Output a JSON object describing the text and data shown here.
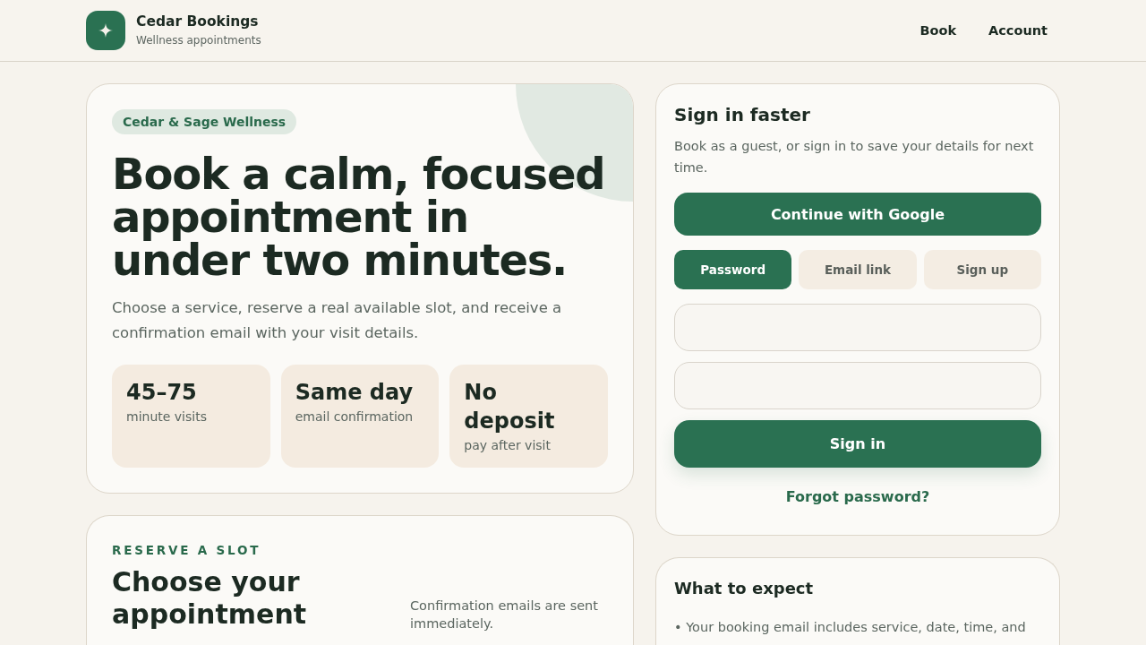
{
  "header": {
    "brand": {
      "name": "Cedar Bookings",
      "tagline": "Wellness appointments"
    },
    "nav": [
      {
        "label": "Book"
      },
      {
        "label": "Account"
      }
    ]
  },
  "hero": {
    "badge": "Cedar & Sage Wellness",
    "title": "Book a calm, focused appointment in under two minutes.",
    "description": "Choose a service, reserve a real available slot, and receive a confirmation email with your visit details.",
    "stats": [
      {
        "value": "45–75",
        "label": "minute visits"
      },
      {
        "value": "Same day",
        "label": "email confirmation"
      },
      {
        "value": "No deposit",
        "label": "pay after visit"
      }
    ]
  },
  "reserve": {
    "kicker": "RESERVE A SLOT",
    "title": "Choose your appointment",
    "note": "Confirmation emails are sent immediately."
  },
  "sign_in": {
    "title": "Sign in faster",
    "description": "Book as a guest, or sign in to save your details for next time.",
    "google_button": "Continue with Google",
    "tabs": [
      {
        "label": "Password",
        "selected": true
      },
      {
        "label": "Email link",
        "selected": false
      },
      {
        "label": "Sign up",
        "selected": false
      }
    ],
    "fields": [
      {
        "kind": "text-field"
      },
      {
        "kind": "text-field"
      }
    ],
    "submit_button": "Sign in",
    "forgot_link": "Forgot password?"
  },
  "expect": {
    "title": "What to expect",
    "items": [
      "• Your booking email includes service, date, time, and"
    ]
  }
}
